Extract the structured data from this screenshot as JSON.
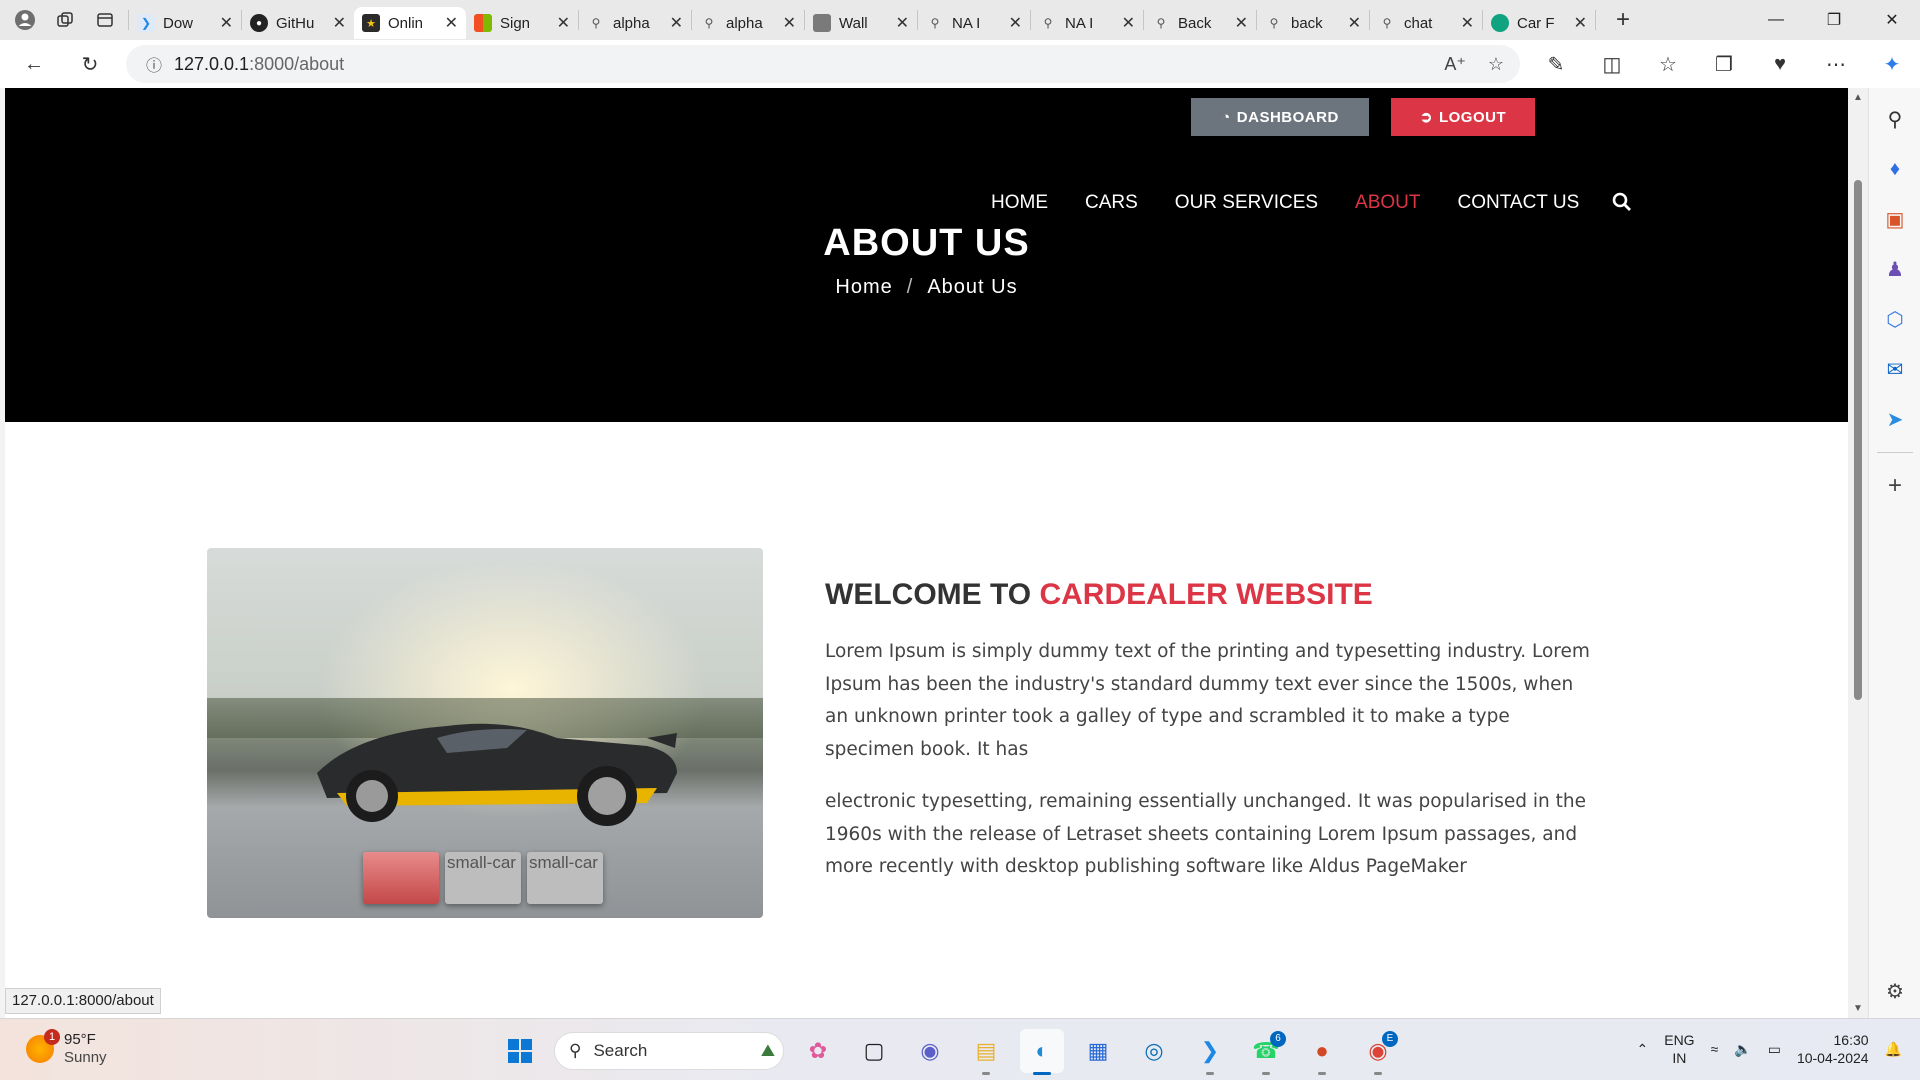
{
  "browser": {
    "tabs": [
      {
        "title": "Dow",
        "icon": "vscode-icon"
      },
      {
        "title": "GitHu",
        "icon": "github-icon"
      },
      {
        "title": "Onlin",
        "icon": "site-logo-icon",
        "active": true
      },
      {
        "title": "Sign",
        "icon": "microsoft-icon"
      },
      {
        "title": "alpha",
        "icon": "search-icon"
      },
      {
        "title": "alpha",
        "icon": "search-icon"
      },
      {
        "title": "Wall",
        "icon": "image-icon"
      },
      {
        "title": "NA I",
        "icon": "search-icon"
      },
      {
        "title": "NA I",
        "icon": "search-icon"
      },
      {
        "title": "Back",
        "icon": "search-icon"
      },
      {
        "title": "back",
        "icon": "search-icon"
      },
      {
        "title": "chat",
        "icon": "search-icon"
      },
      {
        "title": "Car F",
        "icon": "chatgpt-icon"
      }
    ],
    "url_host": "127.0.0.1",
    "url_path": ":8000/about",
    "status_url": "127.0.0.1:8000/about"
  },
  "page": {
    "buttons": {
      "dashboard": "DASHBOARD",
      "logout": "LOGOUT"
    },
    "nav": [
      {
        "label": "HOME",
        "active": false
      },
      {
        "label": "CARS",
        "active": false
      },
      {
        "label": "OUR SERVICES",
        "active": false
      },
      {
        "label": "ABOUT",
        "active": true
      },
      {
        "label": "CONTACT US",
        "active": false
      }
    ],
    "hero_title": "ABOUT US",
    "breadcrumb": {
      "home": "Home",
      "sep": "/",
      "current": "About Us"
    },
    "welcome_prefix": "WELCOME TO",
    "welcome_highlight": "CARDEALER WEBSITE",
    "paragraph1": "Lorem Ipsum is simply dummy text of the printing and typesetting industry. Lorem Ipsum has been the industry's standard dummy text ever since the 1500s, when an unknown printer took a galley of type and scrambled it to make a type specimen book. It has",
    "paragraph2": "electronic typesetting, remaining essentially unchanged. It was popularised in the 1960s with the release of Letraset sheets containing Lorem Ipsum passages, and more recently with desktop publishing software like Aldus PageMaker",
    "thumb_alt": "small-car",
    "accent_color": "#dc3545"
  },
  "taskbar": {
    "temperature": "95°F",
    "condition": "Sunny",
    "weather_badge": "1",
    "search_label": "Search",
    "whatsapp_count": "6",
    "chrome_badge": "E",
    "lang_top": "ENG",
    "lang_bottom": "IN",
    "time": "16:30",
    "date": "10-04-2024"
  }
}
